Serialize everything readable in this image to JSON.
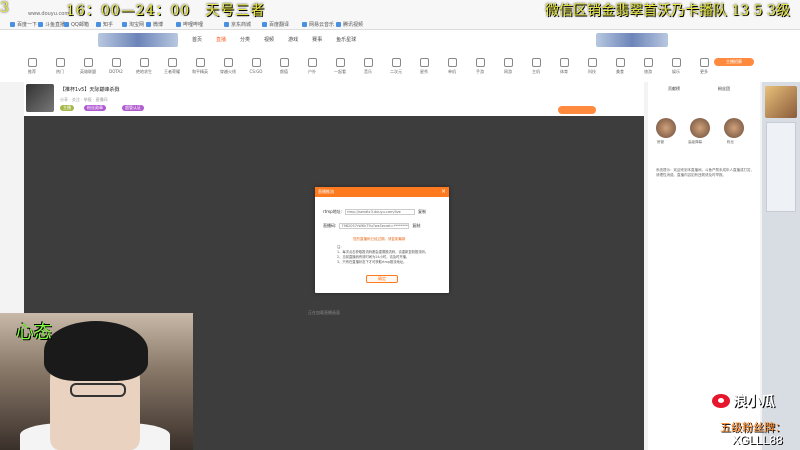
{
  "overlay": {
    "left_num": "3",
    "time": "16：00—24：00　天号三者",
    "promo": "微信区销金翡翠首沃乃卡播队 13 5 3级",
    "cam_label": "心态",
    "weibo_name": "浪小瓜",
    "fan_level": "五级粉丝牌：",
    "fan_id": "XGLLL88"
  },
  "browser": {
    "url": "www.douyu.com",
    "bookmarks": [
      "百度一下",
      "斗鱼直播",
      "QQ邮箱",
      "知乎",
      "淘宝网",
      "微博",
      "哔哩哔哩",
      "京东商城",
      "百度翻译",
      "网易云音乐",
      "腾讯视频"
    ]
  },
  "site": {
    "nav_tabs": [
      "首页",
      "直播",
      "分类",
      "视频",
      "游戏",
      "赛事",
      "鱼乐星球"
    ],
    "header_btn": "主播招募",
    "categories": [
      "推荐",
      "热门",
      "英雄联盟",
      "DOTA2",
      "绝地求生",
      "王者荣耀",
      "和平精英",
      "穿越火线",
      "CS:GO",
      "颜值",
      "户外",
      "一起看",
      "音乐",
      "二次元",
      "星秀",
      "单机",
      "手游",
      "网游",
      "主机",
      "体育",
      "科技",
      "美食",
      "旅游",
      "娱乐",
      "更多"
    ]
  },
  "room": {
    "title": "【推杯1v5】天际巅峰杀戮",
    "meta": "分享 · 关注 · 举报 · 直播间",
    "tags": [
      "主播",
      "粉丝勋章",
      "超管认证"
    ],
    "hint": "正在加载直播画面"
  },
  "modal": {
    "title": "直播推流",
    "close": "×",
    "rtmp_label": "rtmp地址:",
    "rtmp_value": "rtmp://sendtc3.douyu.com/live",
    "code_label": "直播码:",
    "code_value": "7982057rWKhT9u?wsSecret=*********",
    "copy": "复制",
    "warn": "您的直播码已经过期，请复制最新",
    "notes_title": "注：",
    "notes": [
      "1、每次点击获取推流码都会重置推流码，请重新复制推流码。",
      "2、当前直播码有效时间为24小时，请及时开播。",
      "3、只有在直播状态下才可获取rtmp推流地址。"
    ],
    "ok": "确定"
  },
  "right_panel": {
    "top_buttons": [
      "贡献榜",
      "粉丝团"
    ],
    "gift_labels": [
      "房管",
      "高级弹幕",
      "粉丝"
    ],
    "chat_text": "系统提示：欢迎来到本直播间，斗鱼严禁未成年人直播或打赏，请理性消费。直播内容如有违规请及时举报。"
  },
  "colors": {
    "accent": "#ff7a1f",
    "overlay_yellow": "#e8e840",
    "overlay_green": "#7dff3a",
    "weibo_red": "#e6162d"
  }
}
